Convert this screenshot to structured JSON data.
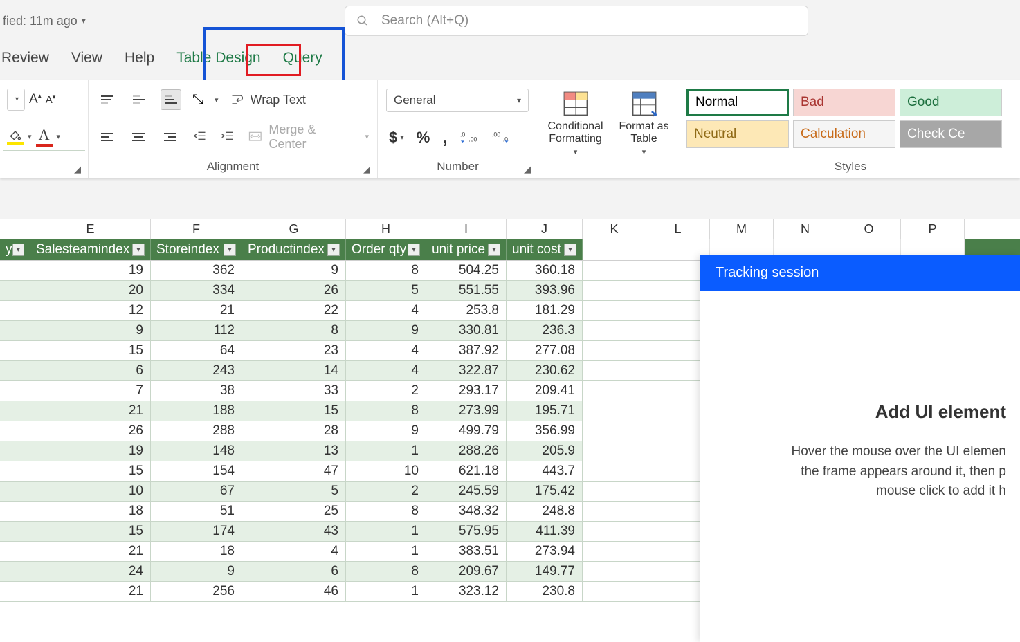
{
  "titlebar": {
    "saved_text": "fied: 11m ago"
  },
  "search": {
    "placeholder": "Search (Alt+Q)"
  },
  "tabs": {
    "review": "Review",
    "view": "View",
    "help": "Help",
    "table_design": "Table Design",
    "query": "Query"
  },
  "ribbon": {
    "wrap_text": "Wrap Text",
    "merge_center": "Merge & Center",
    "alignment_label": "Alignment",
    "number_format": "General",
    "number_label": "Number",
    "cond_format": "Conditional Formatting",
    "format_table": "Format as Table",
    "styles_label": "Styles",
    "styles": {
      "normal": "Normal",
      "bad": "Bad",
      "good": "Good",
      "neutral": "Neutral",
      "calculation": "Calculation",
      "check_cell": "Check Ce"
    }
  },
  "sheet": {
    "col_letters": [
      "E",
      "F",
      "G",
      "H",
      "I",
      "J",
      "K",
      "L",
      "M",
      "N",
      "O",
      "P"
    ],
    "th_partial": "y",
    "headers": [
      "Salesteamindex",
      "Storeindex",
      "Productindex",
      "Order qty",
      "unit price",
      "unit cost"
    ],
    "rows": [
      [
        "19",
        "362",
        "9",
        "8",
        "504.25",
        "360.18"
      ],
      [
        "20",
        "334",
        "26",
        "5",
        "551.55",
        "393.96"
      ],
      [
        "12",
        "21",
        "22",
        "4",
        "253.8",
        "181.29"
      ],
      [
        "9",
        "112",
        "8",
        "9",
        "330.81",
        "236.3"
      ],
      [
        "15",
        "64",
        "23",
        "4",
        "387.92",
        "277.08"
      ],
      [
        "6",
        "243",
        "14",
        "4",
        "322.87",
        "230.62"
      ],
      [
        "7",
        "38",
        "33",
        "2",
        "293.17",
        "209.41"
      ],
      [
        "21",
        "188",
        "15",
        "8",
        "273.99",
        "195.71"
      ],
      [
        "26",
        "288",
        "28",
        "9",
        "499.79",
        "356.99"
      ],
      [
        "19",
        "148",
        "13",
        "1",
        "288.26",
        "205.9"
      ],
      [
        "15",
        "154",
        "47",
        "10",
        "621.18",
        "443.7"
      ],
      [
        "10",
        "67",
        "5",
        "2",
        "245.59",
        "175.42"
      ],
      [
        "18",
        "51",
        "25",
        "8",
        "348.32",
        "248.8"
      ],
      [
        "15",
        "174",
        "43",
        "1",
        "575.95",
        "411.39"
      ],
      [
        "21",
        "18",
        "4",
        "1",
        "383.51",
        "273.94"
      ],
      [
        "24",
        "9",
        "6",
        "8",
        "209.67",
        "149.77"
      ],
      [
        "21",
        "256",
        "46",
        "1",
        "323.12",
        "230.8"
      ]
    ]
  },
  "tracking": {
    "title": "Tracking session",
    "heading": "Add UI element",
    "body1": "Hover the mouse over the UI elemen",
    "body2": "the frame appears around it, then p",
    "body3": "mouse click to add it h"
  }
}
